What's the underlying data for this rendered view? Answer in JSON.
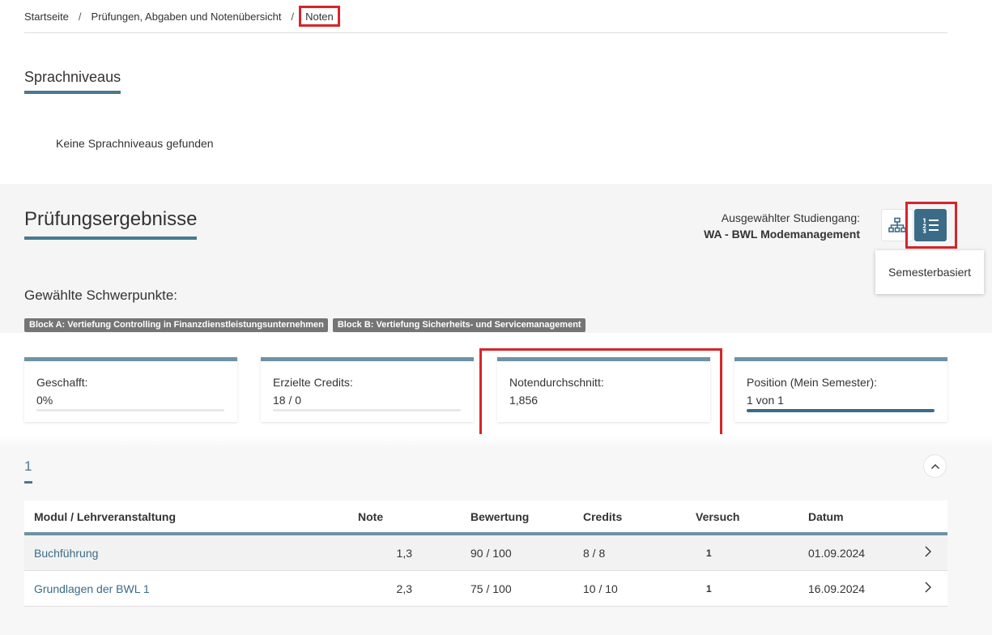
{
  "breadcrumb": {
    "items": [
      "Startseite",
      "Prüfungen, Abgaben und Notenübersicht"
    ],
    "current": "Noten",
    "separator": "/"
  },
  "sprachniveaus": {
    "title": "Sprachniveaus",
    "empty_message": "Keine Sprachniveaus gefunden"
  },
  "pruefungsergebnisse": {
    "title": "Prüfungsergebnisse",
    "studiengang_label": "Ausgewählter Studiengang:",
    "studiengang_value": "WA - BWL Modemanagement",
    "tooltip": "Semesterbasiert",
    "view_icons": [
      "hierarchy-icon",
      "numbered-list-icon"
    ]
  },
  "schwerpunkte": {
    "title": "Gewählte Schwerpunkte:",
    "tags": [
      "Block A: Vertiefung Controlling in Finanzdienstleistungsunternehmen",
      "Block B: Vertiefung Sicherheits- und Servicemanagement"
    ]
  },
  "stats": [
    {
      "label": "Geschafft:",
      "value": "0%",
      "progress": 0
    },
    {
      "label": "Erzielte Credits:",
      "value": "18 / 0",
      "progress": 0
    },
    {
      "label": "Notendurchschnitt:",
      "value": "1,856"
    },
    {
      "label": "Position (Mein Semester):",
      "value": "1 von 1",
      "progress": 1
    }
  ],
  "semester": {
    "label": "1"
  },
  "table": {
    "headers": [
      "Modul / Lehrveranstaltung",
      "Note",
      "Bewertung",
      "Credits",
      "Versuch",
      "Datum"
    ],
    "rows": [
      {
        "modul": "Buchführung",
        "note": "1,3",
        "bewertung": "90 / 100",
        "credits": "8 / 8",
        "versuch": "1",
        "datum": "01.09.2024"
      },
      {
        "modul": "Grundlagen der BWL 1",
        "note": "2,3",
        "bewertung": "75 / 100",
        "credits": "10 / 10",
        "versuch": "1",
        "datum": "16.09.2024"
      }
    ]
  },
  "colors": {
    "accent": "#4a7891",
    "button_active": "#3b6b86",
    "highlight_red": "#d6252a",
    "tag_bg": "#757575"
  }
}
